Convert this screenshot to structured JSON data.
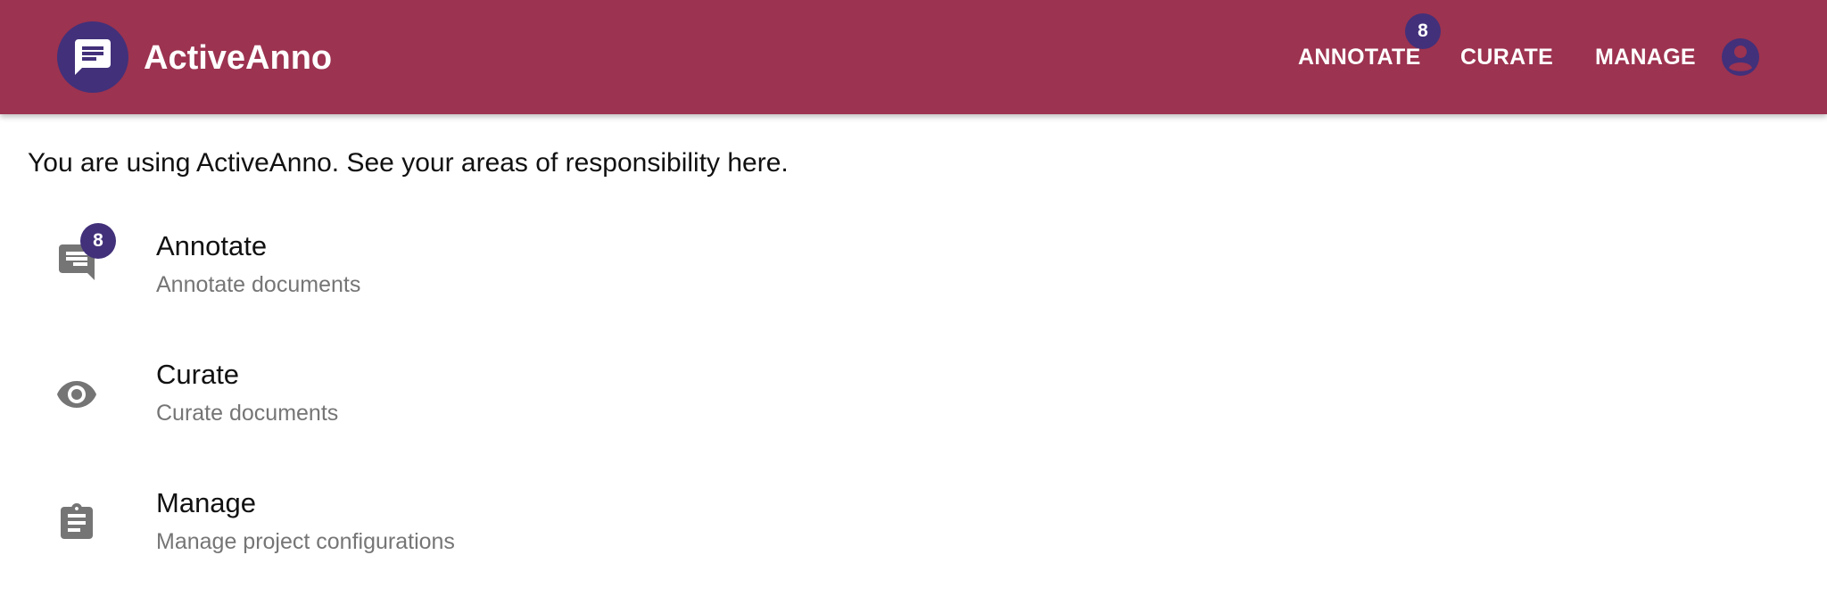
{
  "app": {
    "title": "ActiveAnno",
    "logo_icon": "chat-message-icon"
  },
  "nav": {
    "annotate": "ANNOTATE",
    "annotate_badge": "8",
    "curate": "CURATE",
    "manage": "MANAGE",
    "account_icon": "account-circle-icon"
  },
  "main": {
    "intro": "You are using ActiveAnno. See your areas of responsibility here.",
    "items": [
      {
        "title": "Annotate",
        "subtitle": "Annotate documents",
        "icon": "chat-message-icon",
        "badge": "8"
      },
      {
        "title": "Curate",
        "subtitle": "Curate documents",
        "icon": "eye-icon"
      },
      {
        "title": "Manage",
        "subtitle": "Manage project configurations",
        "icon": "clipboard-icon"
      }
    ]
  },
  "colors": {
    "appbar": "#9c3350",
    "accent": "#42307a",
    "icon_gray": "#757575"
  }
}
